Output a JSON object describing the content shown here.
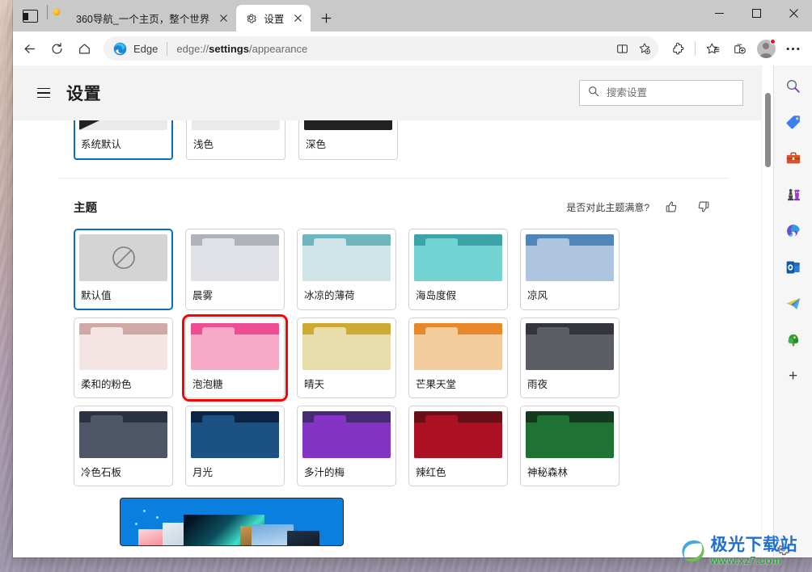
{
  "window": {
    "minimize_label": "最小化",
    "maximize_label": "最大化",
    "close_label": "关闭"
  },
  "tabs": {
    "tab_search_label": "选项卡搜索",
    "new_tab_label": "新建标签页",
    "items": [
      {
        "title": "360导航_一个主页，整个世界",
        "favicon": "360-favicon",
        "active": false,
        "close_label": "×"
      },
      {
        "title": "设置",
        "favicon": "gear-icon",
        "active": true,
        "close_label": "×"
      }
    ]
  },
  "toolbar": {
    "back_label": "返回",
    "refresh_label": "刷新",
    "home_label": "主页",
    "brand": "Edge",
    "url_prefix": "edge://",
    "url_bold": "settings",
    "url_suffix": "/appearance",
    "url_full": "edge://settings/appearance",
    "split_screen_label": "拆分屏幕",
    "add_favorite_label": "添加到收藏夹",
    "extensions_label": "扩展",
    "favorites_label": "收藏夹",
    "collections_label": "集锦",
    "profile_label": "个人资料",
    "more_label": "设置及其他"
  },
  "settings": {
    "menu_label": "设置菜单",
    "title": "设置",
    "search": {
      "placeholder": "搜索设置",
      "value": "",
      "icon": "search-icon"
    }
  },
  "appearance_modes": {
    "items": [
      {
        "label": "系统默认",
        "thumb": "system",
        "selected": true
      },
      {
        "label": "浅色",
        "thumb": "light",
        "selected": false
      },
      {
        "label": "深色",
        "thumb": "dark",
        "selected": false
      }
    ]
  },
  "theme_section": {
    "title": "主题",
    "feedback_question": "是否对此主题满意?",
    "thumbs_up_label": "满意",
    "thumbs_down_label": "不满意",
    "themes": [
      {
        "label": "默认值",
        "selected": true,
        "annotated": false,
        "none": true,
        "top": "#c9c9c9",
        "tab": "#dcdcdc",
        "body": "#d4d4d4"
      },
      {
        "label": "晨雾",
        "selected": false,
        "annotated": false,
        "top": "#aeb2bb",
        "tab": "#dfe1e6",
        "body": "#dfe1e6"
      },
      {
        "label": "冰凉的薄荷",
        "selected": false,
        "annotated": false,
        "top": "#6fb6bf",
        "tab": "#cfe4e7",
        "body": "#cfe4e7"
      },
      {
        "label": "海岛度假",
        "selected": false,
        "annotated": false,
        "top": "#3ea3a8",
        "tab": "#74d3d3",
        "body": "#74d3d3"
      },
      {
        "label": "凉风",
        "selected": false,
        "annotated": false,
        "top": "#5186b8",
        "tab": "#adc5de",
        "body": "#adc5de"
      },
      {
        "label": "柔和的粉色",
        "selected": false,
        "annotated": false,
        "top": "#cfa9a6",
        "tab": "#f4e4e3",
        "body": "#f4e4e3"
      },
      {
        "label": "泡泡糖",
        "selected": false,
        "annotated": true,
        "top": "#ee4d93",
        "tab": "#f7abc8",
        "body": "#f7abc8"
      },
      {
        "label": "晴天",
        "selected": false,
        "annotated": false,
        "top": "#ccaa33",
        "tab": "#e8dcaa",
        "body": "#e8dcaa"
      },
      {
        "label": "芒果天堂",
        "selected": false,
        "annotated": false,
        "top": "#e8882a",
        "tab": "#f3cc9e",
        "body": "#f3cc9e"
      },
      {
        "label": "雨夜",
        "selected": false,
        "annotated": false,
        "top": "#33353a",
        "tab": "#5a5d63",
        "body": "#5a5d63"
      },
      {
        "label": "冷色石板",
        "selected": false,
        "annotated": false,
        "top": "#2b3240",
        "tab": "#4e5668",
        "body": "#4e5668"
      },
      {
        "label": "月光",
        "selected": false,
        "annotated": false,
        "top": "#0d2544",
        "tab": "#1b5183",
        "body": "#1b5183"
      },
      {
        "label": "多汁的梅",
        "selected": false,
        "annotated": false,
        "top": "#472a74",
        "tab": "#8434c4",
        "body": "#8434c4"
      },
      {
        "label": "辣红色",
        "selected": false,
        "annotated": false,
        "top": "#6a0f17",
        "tab": "#ab1122",
        "body": "#ab1122"
      },
      {
        "label": "神秘森林",
        "selected": false,
        "annotated": false,
        "top": "#133a1f",
        "tab": "#1f7134",
        "body": "#1f7134"
      }
    ]
  },
  "promo": {
    "label": "主题集合横幅",
    "background": "#0b7fe0"
  },
  "edge_sidebar": {
    "items": [
      {
        "name": "search-icon",
        "label": "搜索"
      },
      {
        "name": "shopping-tag-icon",
        "label": "购物"
      },
      {
        "name": "tools-briefcase-icon",
        "label": "工具"
      },
      {
        "name": "games-chess-icon",
        "label": "游戏"
      },
      {
        "name": "microsoft365-icon",
        "label": "Microsoft 365"
      },
      {
        "name": "outlook-icon",
        "label": "Outlook"
      },
      {
        "name": "telegram-icon",
        "label": "消息"
      },
      {
        "name": "tree-icon",
        "label": "Edge 树"
      },
      {
        "name": "add-icon",
        "label": "自定义"
      }
    ]
  },
  "watermark": {
    "cn": "极光下载站",
    "en": "www.xz7.com"
  },
  "colors": {
    "accent_blue": "#0f6cbd",
    "annotation_red": "#ff0000",
    "titlebar": "#c9c9c9",
    "settings_bg": "#f3f3f3"
  }
}
